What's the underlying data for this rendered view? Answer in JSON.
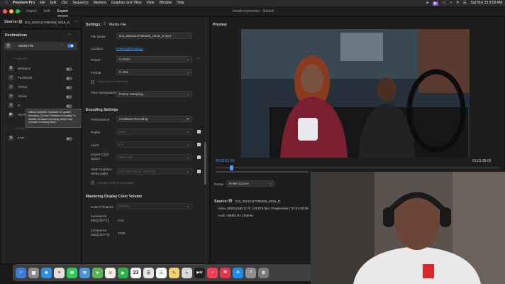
{
  "menubar": {
    "app": "Premiere Pro",
    "items": [
      "File",
      "Edit",
      "Clip",
      "Sequence",
      "Markers",
      "Graphics and Titles",
      "View",
      "Window",
      "Help"
    ],
    "datetime": "Sat Nov 23  9:59 AM"
  },
  "header": {
    "tabs": [
      "Import",
      "Edit",
      "Export"
    ],
    "active_tab": "Export",
    "project": "leniah november - Edited"
  },
  "source_bar": {
    "label": "Source:",
    "file": "DJI_20241117065256_0016_D"
  },
  "destinations": {
    "title": "Destinations",
    "media_file": "Media File",
    "publish_label": "PUBLISH",
    "items": [
      "Behance",
      "Facebook",
      "TikTok",
      "Vimeo",
      "X",
      "YouTube"
    ],
    "cloud_label": "CLOUD",
    "ftp": "FTP"
  },
  "tooltip": "Utilizes available hardware for quicker encoding. Choose \"Software Encoding\" to disable hardware encoding, which may increase encoding times.",
  "settings": {
    "title": "Settings:",
    "subtitle": "Media File",
    "file_name_label": "File Name",
    "file_name": "DJI_20241117065256_0016_D.mp4",
    "location_label": "Location",
    "location": "/Users/gb/Desktop",
    "preset_label": "Preset",
    "preset": "Custom",
    "format_label": "Format",
    "format": "H.264",
    "match_source": "Match Source Frame Rate",
    "time_interp_label": "Time Interpolation",
    "time_interp": "Frame Sampling",
    "encoding_title": "Encoding Settings",
    "performance_label": "Performance",
    "performance": "Hardware Encoding",
    "profile_label": "Profile",
    "profile": "Main",
    "level_label": "Level",
    "level": "5.1",
    "export_color_label": "Export Color Space",
    "export_color": "Rec. 709",
    "hdr_label": "HDR Graphics White (Nits)",
    "hdr": "203 (58% HLG, 75% PQ)",
    "include_hdr": "Include HDR10 Metadata",
    "mastering_title": "Mastering Display Color Volume",
    "primaries_label": "Color Primaries",
    "primaries": "P3D65",
    "lum_min_label": "Luminance Min(cd/m^2)",
    "lum_min": "0.01",
    "lum_max_label": "Luminance Max(cd/m^2)",
    "lum_max": "1000"
  },
  "preview": {
    "title": "Preview",
    "timecode": "00:03:51:19",
    "duration": "01:01:35:09",
    "range_label": "Range",
    "range": "Entire Source",
    "source_label": "Source:",
    "source_file": "DJI_20241117065256_0016_D",
    "video_label": "Video",
    "video_info": "3840x2160 (1.0)  |  23.976 fps  |  Progressive  |  01:01:35:09",
    "audio_label": "Audio",
    "audio_info": "48000 Hz  |  Stereo"
  },
  "dock": {
    "calendar_day": "23"
  },
  "colors": {
    "accent": "#2d7ff9",
    "timecode": "#4a9eff",
    "badge": "#8e5ad6"
  }
}
